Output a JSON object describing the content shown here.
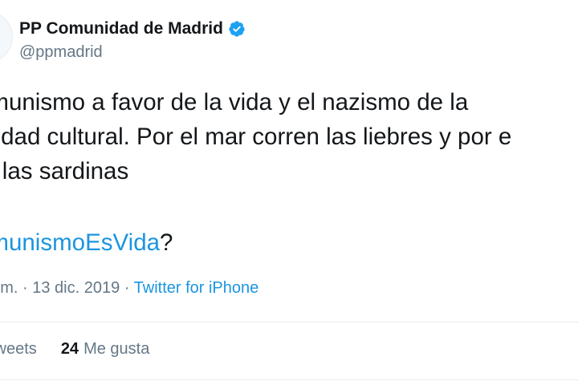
{
  "author": {
    "display_name": "PP Comunidad de Madrid",
    "handle": "@ppmadrid",
    "verified": true
  },
  "tweet": {
    "lines": [
      "omunismo a favor de la vida y el nazismo de la",
      "rsidad cultural. Por el mar corren las liebres y por e",
      "te las sardinas"
    ],
    "hashtag": "omunismoEsVida",
    "hashtag_suffix": "?"
  },
  "meta": {
    "time": "p. m.",
    "separator1": " · ",
    "date": "13 dic. 2019",
    "separator2": " · ",
    "source": "Twitter for iPhone"
  },
  "stats": {
    "retweets_label": "tweets",
    "likes_count": "24",
    "likes_label": "Me gusta"
  },
  "colors": {
    "link": "#1b95e0",
    "verified": "#1da1f2",
    "muted": "#657786"
  }
}
